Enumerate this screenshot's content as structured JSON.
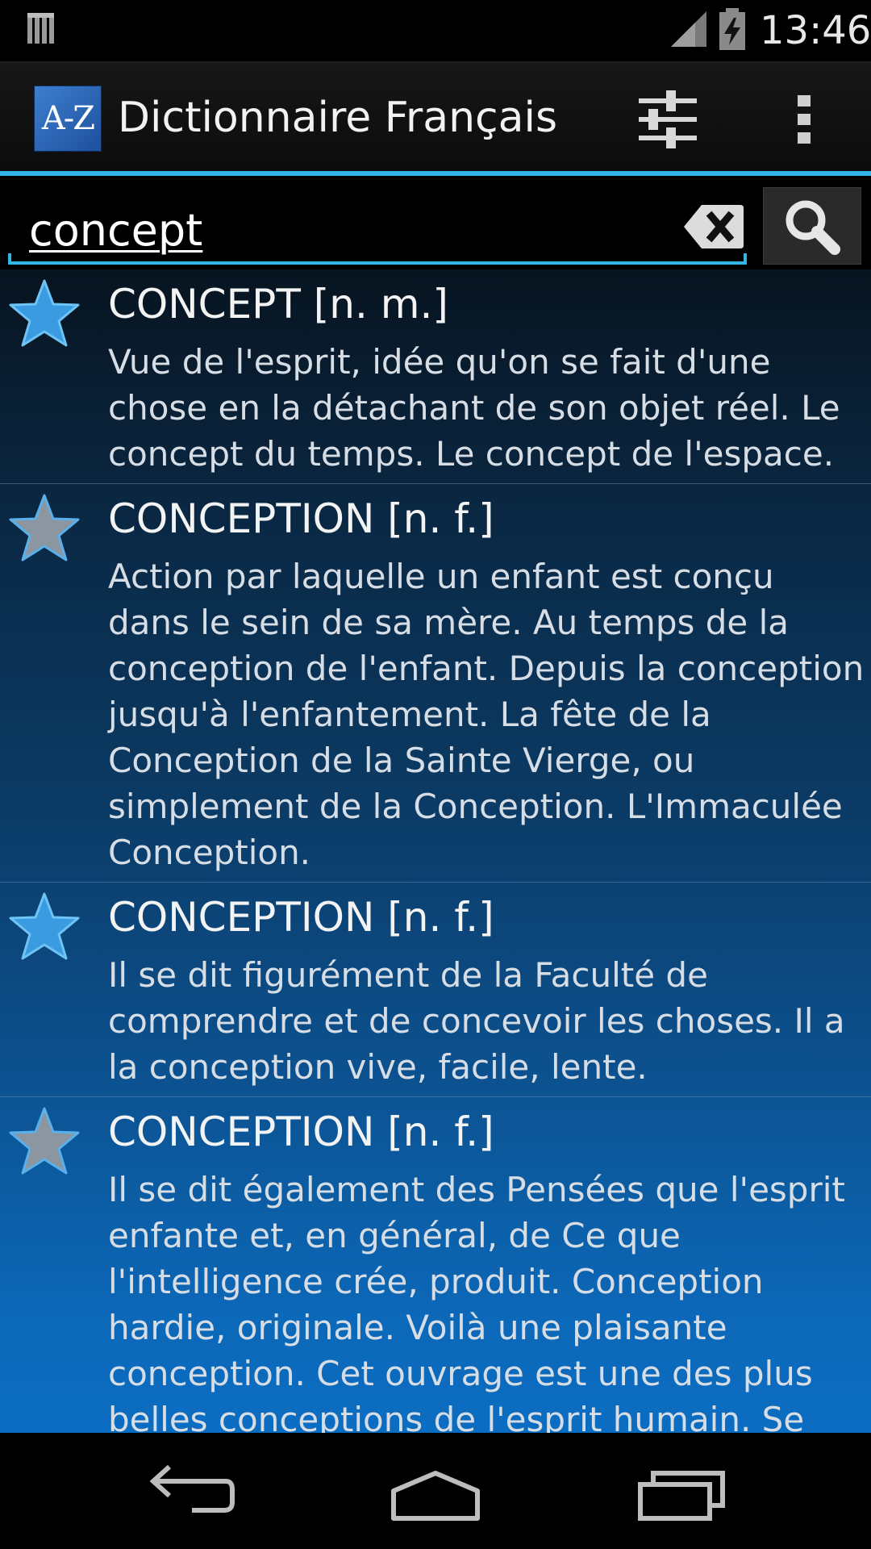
{
  "status_bar": {
    "time": "13:46",
    "icons": [
      "notification-icon",
      "signal-icon",
      "battery-charging-icon"
    ]
  },
  "action_bar": {
    "logo_text": "A-Z",
    "title": "Dictionnaire Français",
    "actions": [
      "settings-sliders-icon",
      "overflow-menu-icon"
    ]
  },
  "search": {
    "query": "concept",
    "clear_icon": "backspace-clear-icon",
    "search_icon": "magnifier-icon"
  },
  "results": [
    {
      "title": "CONCEPT [n. m.]",
      "definition": "Vue de l'esprit, idée qu'on se fait d'une chose en la détachant de son objet réel. Le concept du temps. Le concept de l'espace.",
      "favorite": true
    },
    {
      "title": "CONCEPTION [n. f.]",
      "definition": "Action par laquelle un enfant est conçu dans le sein de sa mère. Au temps de la conception de l'enfant. Depuis la conception jusqu'à l'enfantement. La fête de la Conception de la Sainte Vierge, ou simplement de la Conception. L'Immaculée Conception.",
      "favorite": false
    },
    {
      "title": "CONCEPTION [n. f.]",
      "definition": "Il se dit figurément de la Faculté de comprendre et de concevoir les choses. Il a la conception vive, facile, lente.",
      "favorite": true
    },
    {
      "title": "CONCEPTION [n. f.]",
      "definition": "Il se dit également des Pensées que l'esprit enfante et, en général, de Ce que l'intelligence crée, produit. Conception hardie, originale. Voilà une plaisante conception. Cet ouvrage est une des plus belles conceptions de l'esprit humain. Se",
      "favorite": false
    }
  ],
  "colors": {
    "accent": "#33b5e5",
    "star_favorite": "#3a9be0",
    "star_default": "#8c96a0"
  },
  "nav_bar": {
    "buttons": [
      "back-icon",
      "home-icon",
      "recents-icon"
    ]
  }
}
